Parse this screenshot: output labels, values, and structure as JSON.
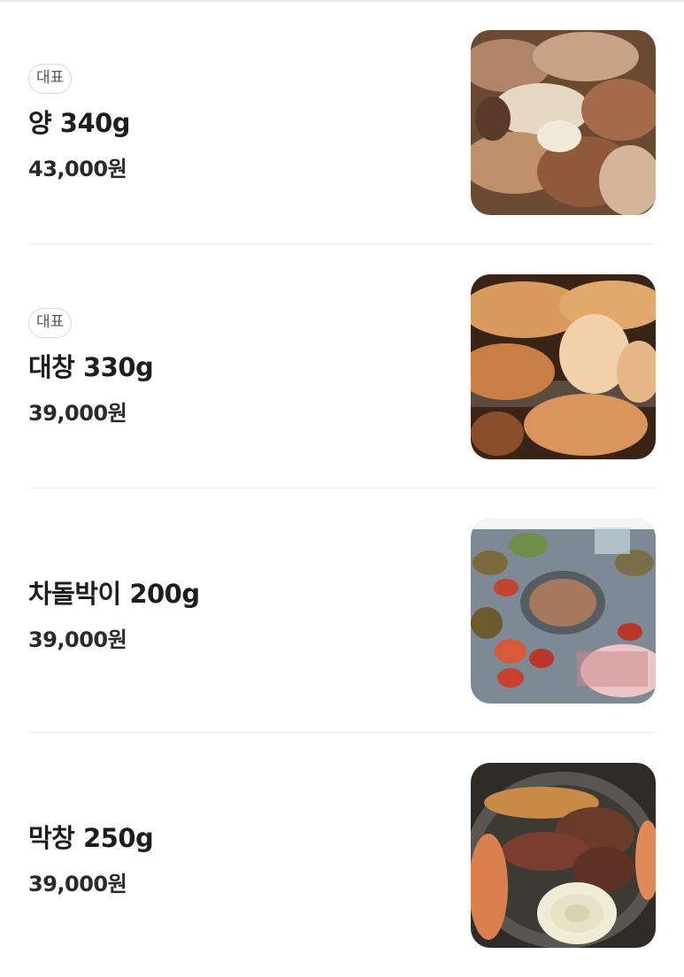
{
  "menu": {
    "items": [
      {
        "badge": "대표",
        "name": "양 340g",
        "price": "43,000원",
        "photo_icon": "grilled-tripe-photo"
      },
      {
        "badge": "대표",
        "name": "대창 330g",
        "price": "39,000원",
        "photo_icon": "grilled-large-intestine-photo"
      },
      {
        "name": "차돌박이 200g",
        "price": "39,000원",
        "photo_icon": "table-spread-photo"
      },
      {
        "name": "막창 250g",
        "price": "39,000원",
        "photo_icon": "grilled-makchang-photo"
      }
    ]
  }
}
